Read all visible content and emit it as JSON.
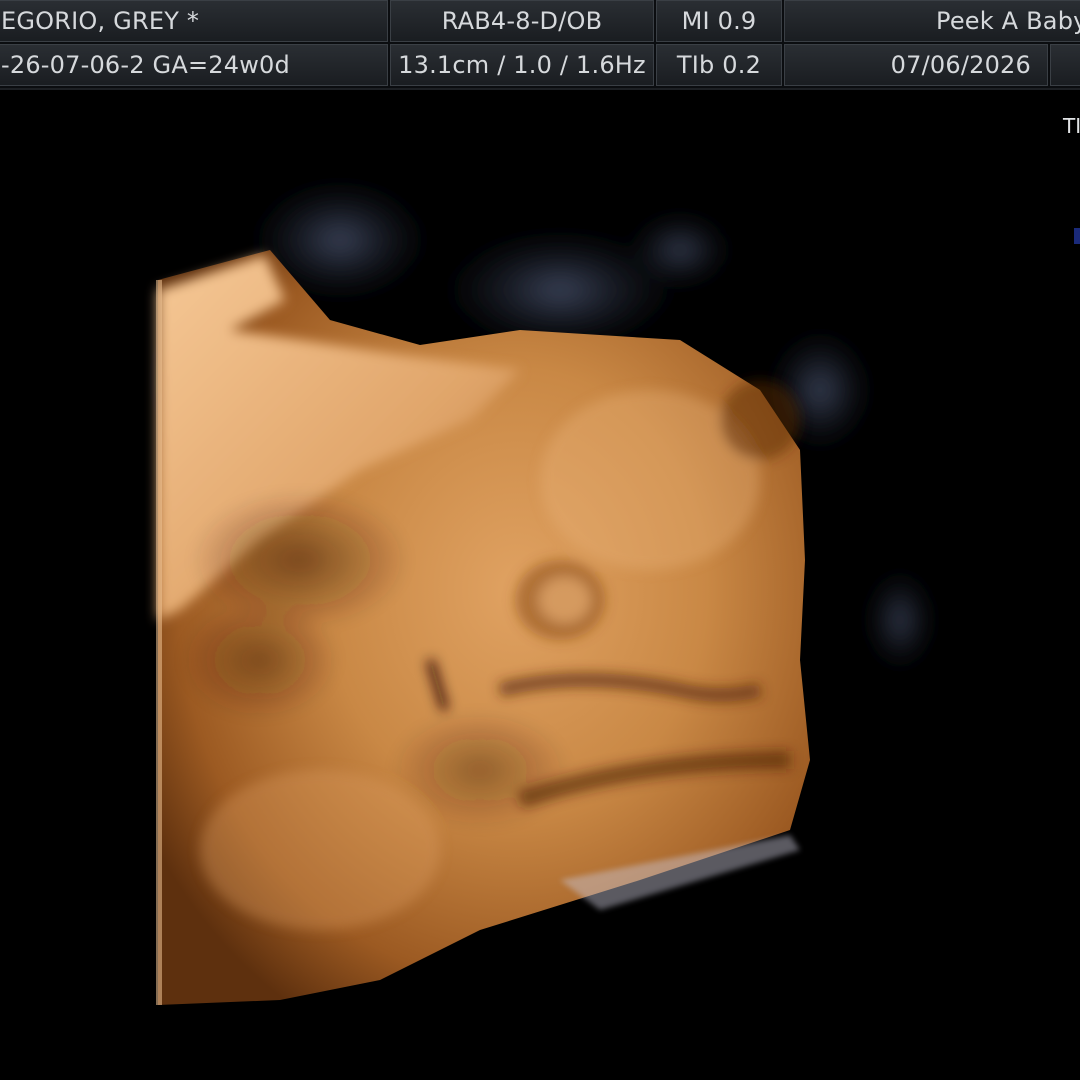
{
  "header": {
    "patient_name": "EGORIO, GREY  *",
    "probe_preset": "RAB4-8-D/OB",
    "mi": "MI  0.9",
    "clinic": "Peek A Baby",
    "exam_id": "-26-07-06-2  GA=24w0d",
    "depth_gain_freq": "13.1cm / 1.0 / 1.6Hz",
    "tib": "TIb  0.2",
    "date": "07/06/2026"
  },
  "side_label": "TI",
  "image": {
    "mode": "3D/4D surface render",
    "tint": "#c9803e"
  }
}
